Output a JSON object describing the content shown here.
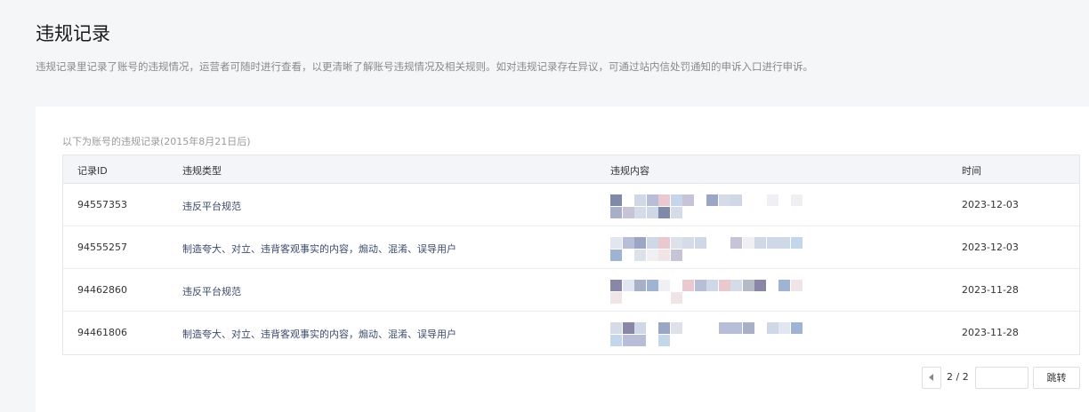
{
  "page": {
    "title": "违规记录",
    "description": "违规记录里记录了账号的违规情况，运营者可随时进行查看，以更清晰了解账号违规情况及相关规则。如对违规记录存在异议，可通过站内信处罚通知的申诉入口进行申诉。"
  },
  "records": {
    "subtitle": "以下为账号的违规记录(2015年8月21日后)",
    "columns": {
      "id": "记录ID",
      "type": "违规类型",
      "content": "违规内容",
      "time": "时间"
    },
    "rows": [
      {
        "id": "94557353",
        "type": "违反平台规范",
        "time": "2023-12-03"
      },
      {
        "id": "94555257",
        "type": "制造夸大、对立、违背客观事实的内容，煽动、混淆、误导用户",
        "time": "2023-12-03"
      },
      {
        "id": "94462860",
        "type": "违反平台规范",
        "time": "2023-11-28"
      },
      {
        "id": "94461806",
        "type": "制造夸大、对立、违背客观事实的内容，煽动、混淆、误导用户",
        "time": "2023-11-28"
      }
    ]
  },
  "pagination": {
    "page_info": "2 / 2",
    "page_input_value": "",
    "jump_label": "跳转"
  },
  "colors": {
    "background": "#f5f6f8",
    "card": "#ffffff",
    "header_row": "#f4f5f9",
    "type_text": "#3c4b6e"
  }
}
